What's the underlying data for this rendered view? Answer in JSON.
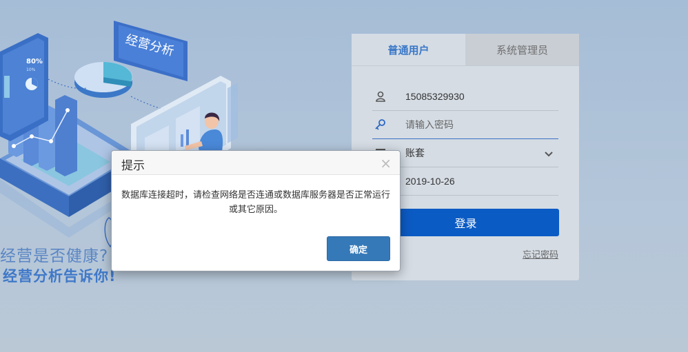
{
  "illustration": {
    "sign_text": "经营分析",
    "percent_80": "80%",
    "percent_10": "10%",
    "slogan_line1": "经营是否健康?",
    "slogan_line2": "经营分析告诉你!"
  },
  "login": {
    "tabs": [
      {
        "label": "普通用户",
        "active": true
      },
      {
        "label": "系统管理员",
        "active": false
      }
    ],
    "username_value": "15085329930",
    "password_placeholder": "请输入密码",
    "account_set_value": "账套",
    "date_value": "2019-10-26",
    "login_button": "登录",
    "forgot_password": "忘记密码"
  },
  "dialog": {
    "title": "提示",
    "close_symbol": "×",
    "message": "数据库连接超时，请检查网络是否连通或数据库服务器是否正常运行或其它原因。",
    "ok_button": "确定"
  },
  "colors": {
    "primary_blue": "#0b5bc4",
    "tab_active_text": "#3a78c8",
    "dialog_button": "#3579b8"
  }
}
